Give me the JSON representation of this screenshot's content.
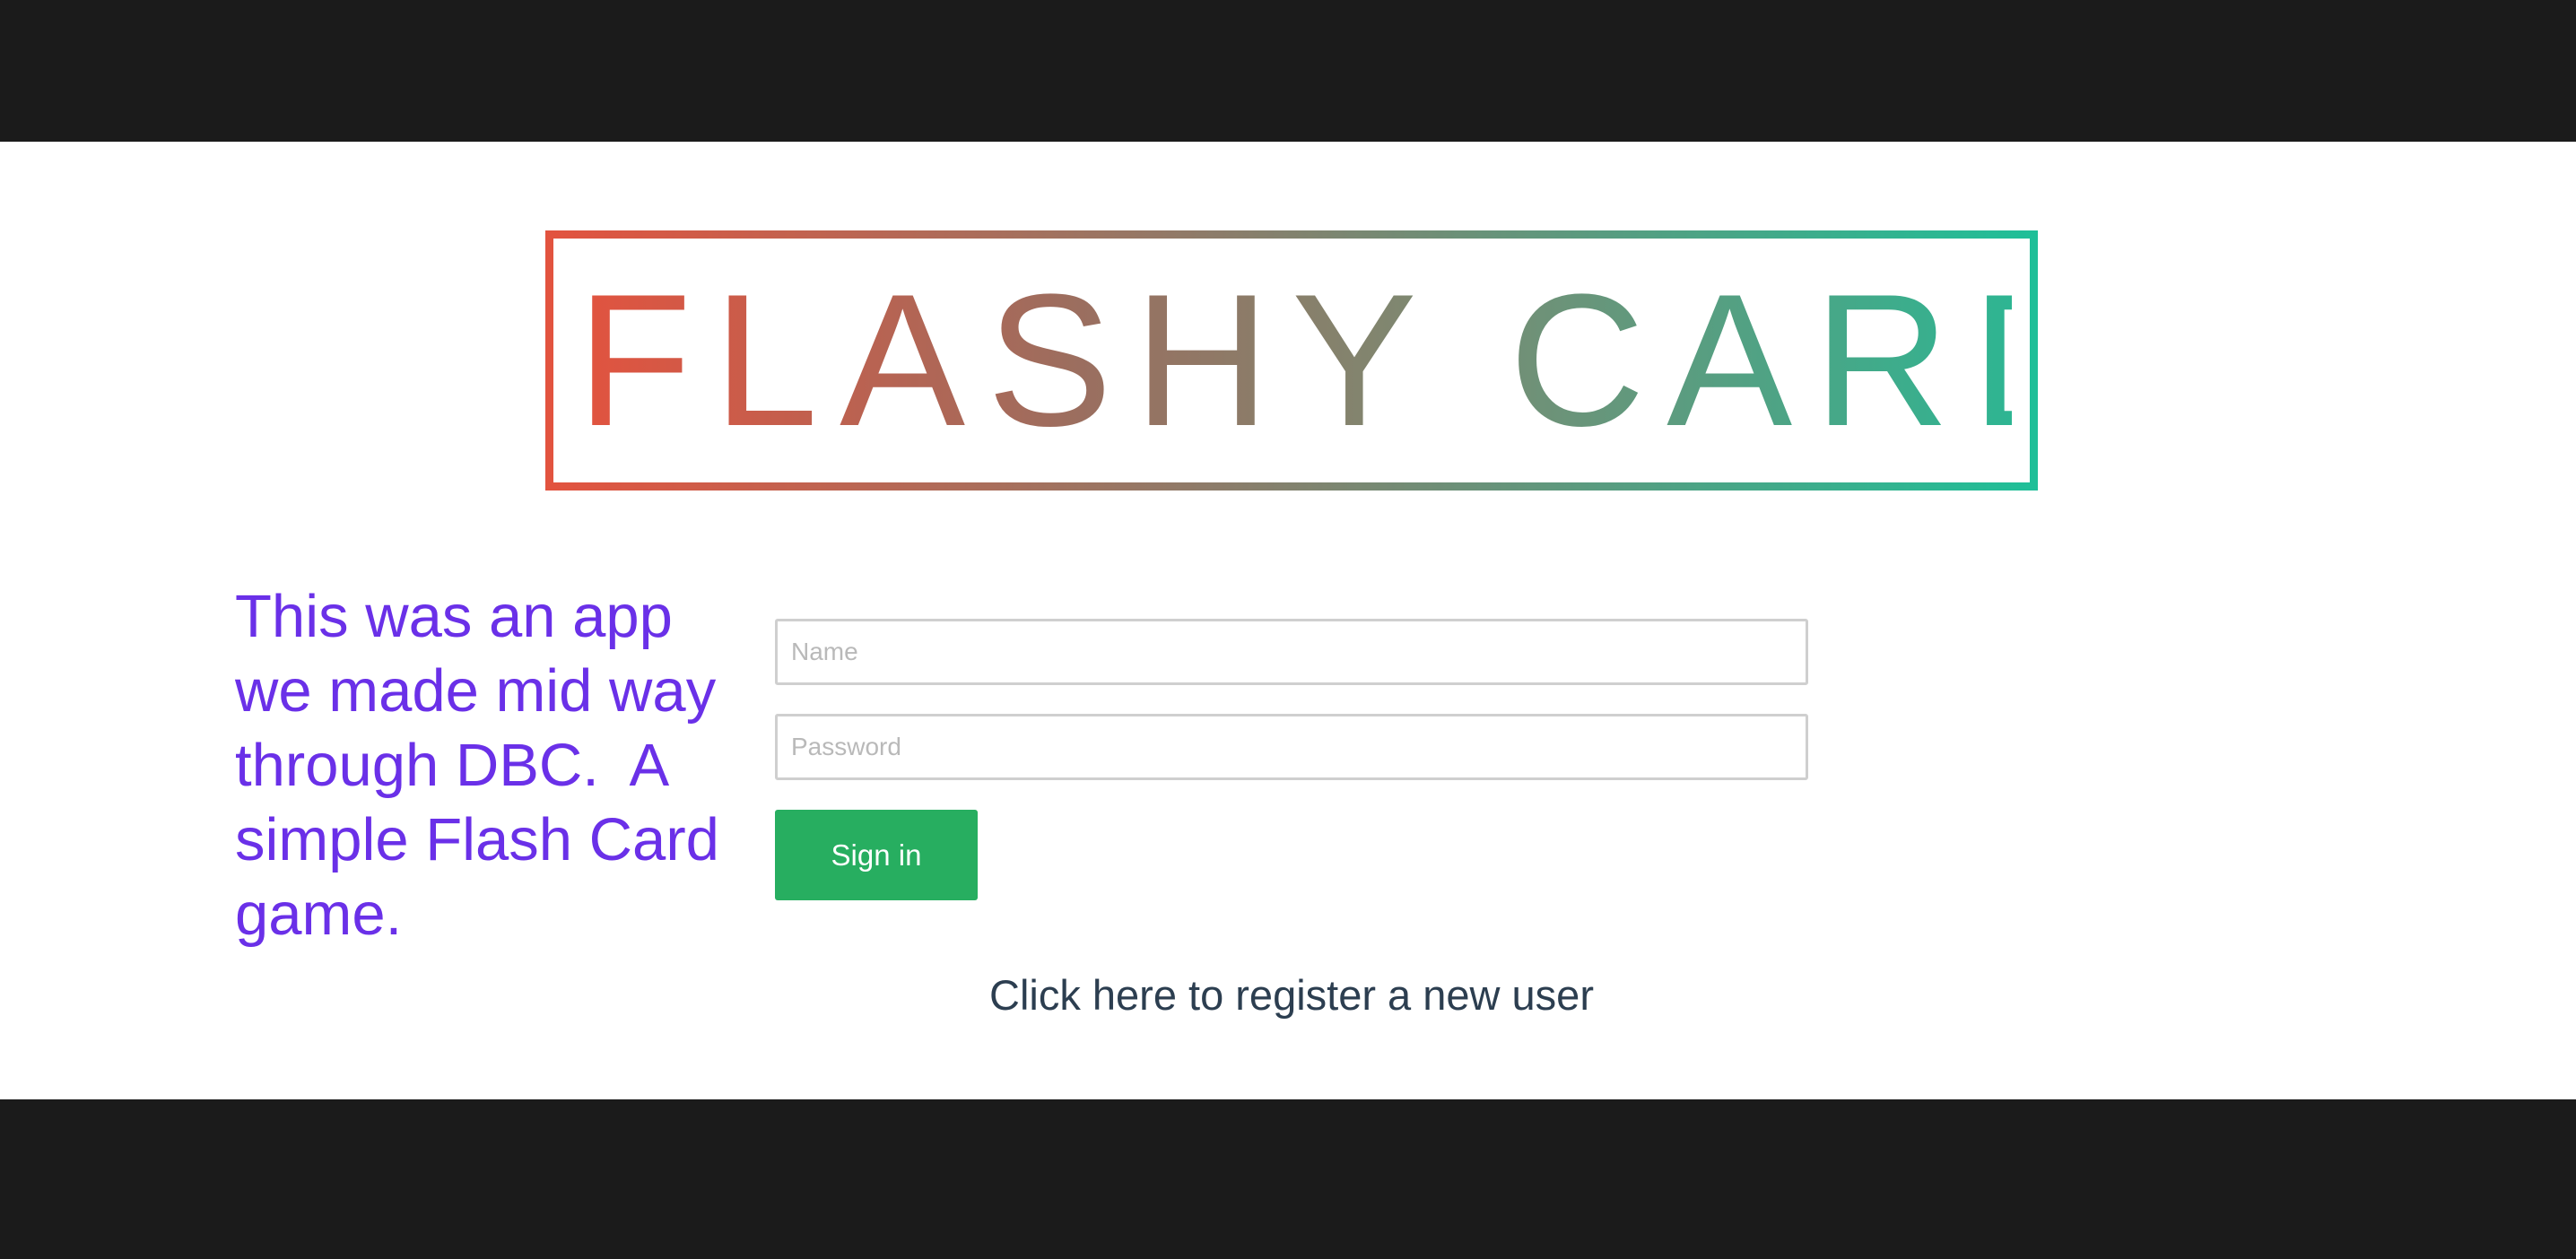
{
  "header": {
    "logo_text": "FLASHY CARDS"
  },
  "intro": {
    "description": "This was an app we made mid way through DBC.  A simple Flash Card game."
  },
  "login_form": {
    "name_placeholder": "Name",
    "password_placeholder": "Password",
    "signin_label": "Sign in"
  },
  "register": {
    "link_text": "Click here to register a new user"
  },
  "colors": {
    "background_band": "#1b1b1b",
    "logo_gradient_start": "#e2533f",
    "logo_gradient_end": "#1fbf98",
    "description_text": "#6a30e8",
    "signin_button": "#27ae60",
    "link_text": "#2c3e50"
  }
}
